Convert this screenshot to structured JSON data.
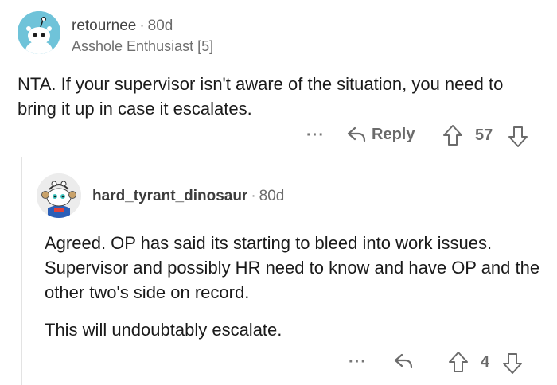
{
  "comment": {
    "username": "retournee",
    "age": "80d",
    "flair": "Asshole Enthusiast [5]",
    "body": "NTA. If your supervisor isn't aware of the situation, you need to bring it up in case it escalates.",
    "reply_label": "Reply",
    "score": "57",
    "more_label": "···"
  },
  "reply": {
    "username": "hard_tyrant_dinosaur",
    "age": "80d",
    "paragraphs": [
      "Agreed. OP has said its starting to bleed into work issues. Supervisor and possibly HR need to know and have OP and the other two's side on record.",
      "This will undoubtably escalate."
    ],
    "score": "4",
    "more_label": "···"
  },
  "separator": "·",
  "icons": {
    "avatar1": "snoo-avatar-icon",
    "avatar2": "snoo-avatar-icon",
    "reply": "reply-arrow-icon",
    "upvote": "upvote-arrow-icon",
    "downvote": "downvote-arrow-icon"
  },
  "colors": {
    "avatar1_bg": "#6fc3d9",
    "thread_line": "#e3e3e3",
    "action_gray": "#6b6b6b"
  }
}
